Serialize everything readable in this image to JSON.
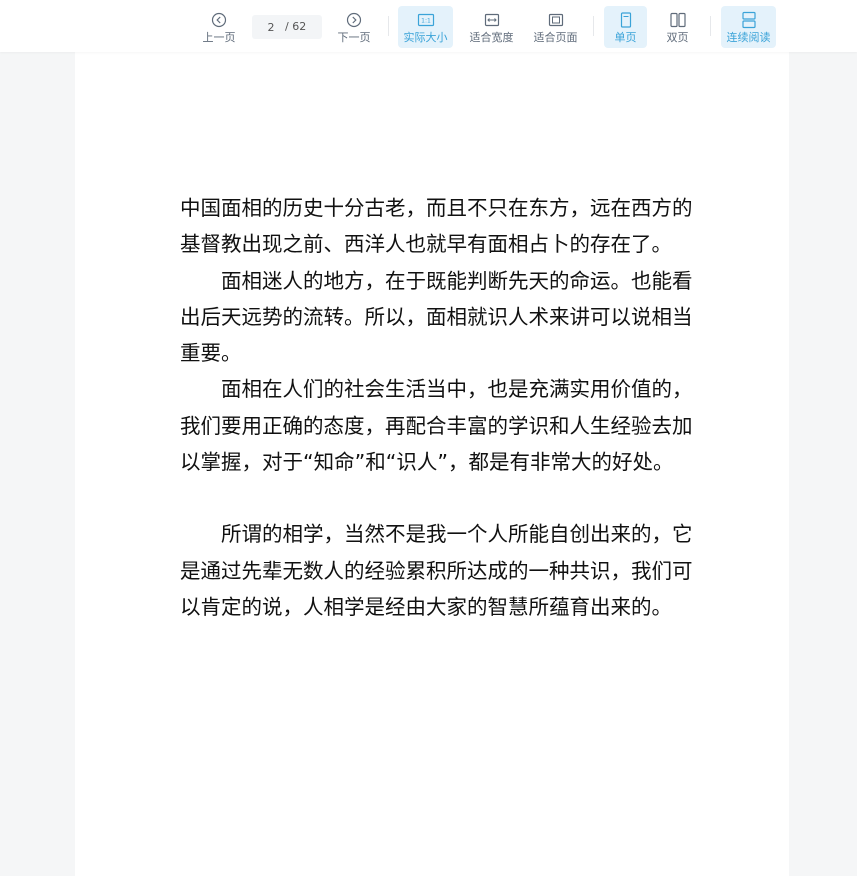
{
  "toolbar": {
    "prev_label": "上一页",
    "next_label": "下一页",
    "current_page": "2",
    "total_pages": "/ 62",
    "actual_size_label": "实际大小",
    "fit_width_label": "适合宽度",
    "fit_page_label": "适合页面",
    "single_page_label": "单页",
    "double_page_label": "双页",
    "continuous_label": "连续阅读",
    "accent_color": "#3aa3d8",
    "active_bg": "#e4f2fb",
    "actual_size_icon_text": "1:1"
  },
  "document": {
    "paragraphs": [
      "中国面相的历史十分古老，而且不只在东方，远在西方的基督教出现之前、西洋人也就早有面相占卜的存在了。",
      "面相迷人的地方，在于既能判断先天的命运。也能看出后天远势的流转。所以，面相就识人术来讲可以说相当重要。",
      "面相在人们的社会生活当中，也是充满实用价值的，我们要用正确的态度，再配合丰富的学识和人生经验去加以掌握，对于“知命”和“识人”，都是有非常大的好处。",
      "所谓的相学，当然不是我一个人所能自创出来的，它是通过先辈无数人的经验累积所达成的一种共识，我们可以肯定的说，人相学是经由大家的智慧所蕴育出来的。"
    ]
  }
}
